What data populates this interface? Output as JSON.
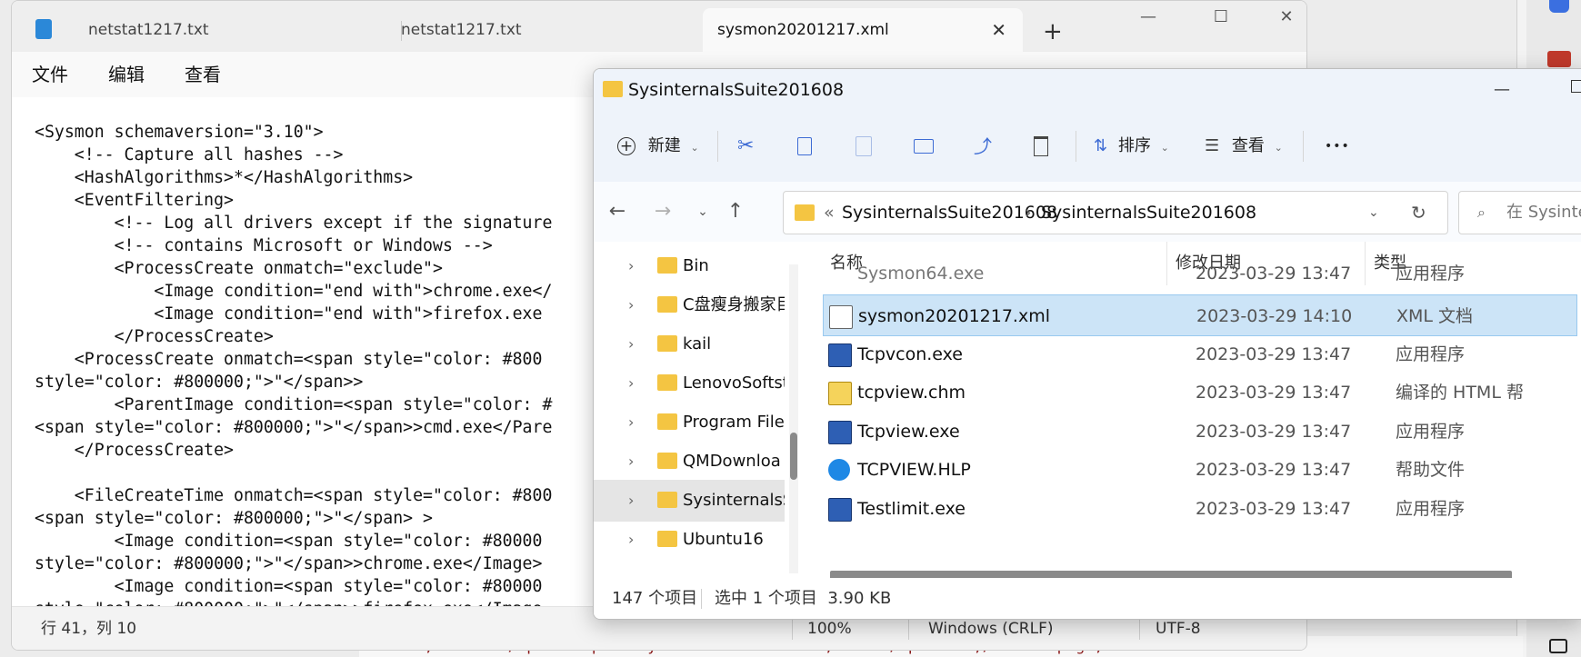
{
  "notepad": {
    "tabs": [
      {
        "label": "netstat1217.txt",
        "active": false
      },
      {
        "label": "netstat1217.txt",
        "active": false
      },
      {
        "label": "sysmon20201217.xml",
        "active": true
      }
    ],
    "new_tab_symbol": "+",
    "menu": [
      "文件",
      "编辑",
      "查看"
    ],
    "text_lines": [
      "<Sysmon schemaversion=\"3.10\">",
      "    <!-- Capture all hashes -->",
      "    <HashAlgorithms>*</HashAlgorithms>",
      "    <EventFiltering>",
      "        <!-- Log all drivers except if the signature",
      "        <!-- contains Microsoft or Windows -->",
      "        <ProcessCreate onmatch=\"exclude\">",
      "            <Image condition=\"end with\">chrome.exe</",
      "            <Image condition=\"end with\">firefox.exe",
      "        </ProcessCreate>",
      "    <ProcessCreate onmatch=<span style=\"color: #800",
      "style=\"color: #800000;\">\"</span>>",
      "        <ParentImage condition=<span style=\"color: #",
      "<span style=\"color: #800000;\">\"</span>>cmd.exe</Pare",
      "    </ProcessCreate>",
      "",
      "    <FileCreateTime onmatch=<span style=\"color: #800",
      "<span style=\"color: #800000;\">\"</span> >",
      "        <Image condition=<span style=\"color: #80000",
      "style=\"color: #800000;\">\"</span>>chrome.exe</Image>",
      "        <Image condition=<span style=\"color: #80000",
      "style=\"color: #800000;\">\"</span>>firefox.exe</Image"
    ],
    "status": {
      "position": "行 41，列 10",
      "zoom": "100%",
      "line_ending": "Windows (CRLF)",
      "encoding": "UTF-8"
    }
  },
  "background_text": "#800080;\">127.0</span>.<span style=\"color: #800080;\">0.1</span>&lt;/SourceIp&gt;",
  "explorer": {
    "title": "SysinternalsSuite201608",
    "toolbar": {
      "new_label": "新建",
      "sort_label": "排序",
      "view_label": "查看",
      "more": "•••"
    },
    "address": {
      "prefix": "«",
      "crumbs": [
        "SysinternalsSuite201608",
        "SysinternalsSuite201608"
      ],
      "separator": "›"
    },
    "search_placeholder": "在 Sysinte",
    "sidebar": [
      {
        "label": "Bin",
        "selected": false
      },
      {
        "label": "C盘瘦身搬家目",
        "selected": false
      },
      {
        "label": "kail",
        "selected": false
      },
      {
        "label": "LenovoSoftst",
        "selected": false
      },
      {
        "label": "Program File",
        "selected": false
      },
      {
        "label": "QMDownloa",
        "selected": false
      },
      {
        "label": "SysinternalsS",
        "selected": true
      },
      {
        "label": "Ubuntu16",
        "selected": false
      }
    ],
    "columns": {
      "name": "名称",
      "date": "修改日期",
      "type": "类型"
    },
    "partial_row": {
      "name": "Sysmon64.exe",
      "date": "2023-03-29 13:47",
      "type": "应用程序"
    },
    "files": [
      {
        "name": "sysmon20201217.xml",
        "date": "2023-03-29 14:10",
        "type": "XML 文档",
        "icon": "xml-file-icon",
        "selected": true
      },
      {
        "name": "Tcpvcon.exe",
        "date": "2023-03-29 13:47",
        "type": "应用程序",
        "icon": "app-exe-icon",
        "selected": false
      },
      {
        "name": "tcpview.chm",
        "date": "2023-03-29 13:47",
        "type": "编译的 HTML 帮",
        "icon": "chm-help-icon",
        "selected": false
      },
      {
        "name": "Tcpview.exe",
        "date": "2023-03-29 13:47",
        "type": "应用程序",
        "icon": "app-exe-icon",
        "selected": false
      },
      {
        "name": "TCPVIEW.HLP",
        "date": "2023-03-29 13:47",
        "type": "帮助文件",
        "icon": "hlp-help-icon",
        "selected": false
      },
      {
        "name": "Testlimit.exe",
        "date": "2023-03-29 13:47",
        "type": "应用程序",
        "icon": "app-exe-icon",
        "selected": false
      }
    ],
    "status": {
      "count": "147 个项目",
      "selection": "选中 1 个项目  3.90 KB"
    }
  }
}
